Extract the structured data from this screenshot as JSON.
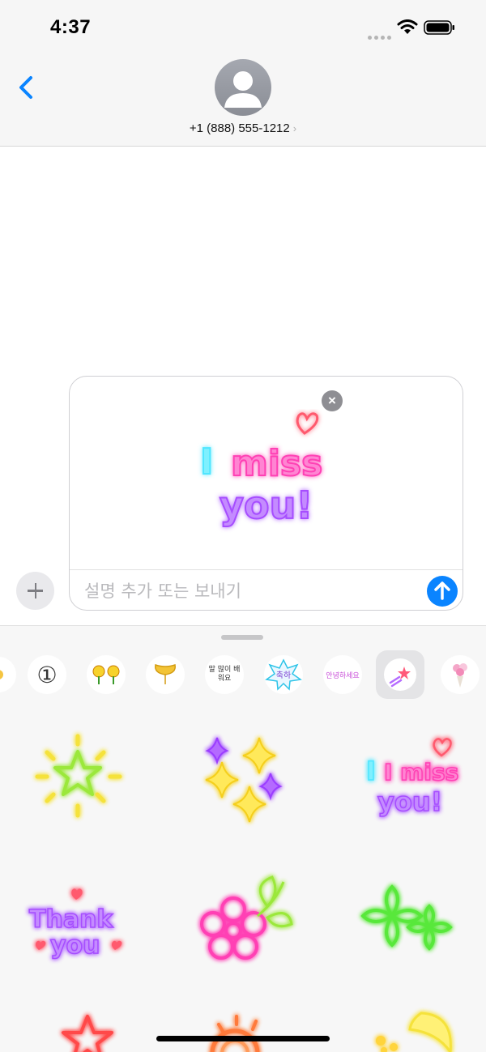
{
  "status_bar": {
    "time": "4:37"
  },
  "header": {
    "contact_name": "+1 (888) 555-1212",
    "chevron": "›"
  },
  "compose": {
    "placeholder": "설명 추가 또는 보내기",
    "attachment": {
      "sticker_lines": [
        "I",
        "miss",
        "you!"
      ]
    },
    "remove_glyph": "×"
  },
  "drawer": {
    "apps": [
      {
        "name": "number-one-sticker-app",
        "glyph": "①"
      },
      {
        "name": "flowers-sticker-app",
        "glyph": "✿✿"
      },
      {
        "name": "ginkgo-sticker-app",
        "glyph": "🍂"
      },
      {
        "name": "korean-text-sticker-app",
        "glyph": "말 많이 배워요"
      },
      {
        "name": "celebrate-sticker-app",
        "glyph": "축하"
      },
      {
        "name": "greeting-sticker-app",
        "glyph": "안녕하세요"
      },
      {
        "name": "neon-sticker-app",
        "glyph": "★"
      },
      {
        "name": "bouquet-sticker-app",
        "glyph": "💐"
      }
    ],
    "stickers": [
      {
        "name": "neon-star-burst",
        "text": ""
      },
      {
        "name": "neon-sparkles",
        "text": ""
      },
      {
        "name": "neon-i-miss-you",
        "text_top": "I miss",
        "text_bottom": "you!"
      },
      {
        "name": "neon-thank-you",
        "text_top": "Thank",
        "text_bottom": "you"
      },
      {
        "name": "neon-flower",
        "text": ""
      },
      {
        "name": "neon-clovers",
        "text": ""
      },
      {
        "name": "neon-star-outline",
        "text": ""
      },
      {
        "name": "neon-sun",
        "text": ""
      },
      {
        "name": "neon-moon",
        "text": ""
      }
    ]
  },
  "colors": {
    "accent": "#0a84ff",
    "neon_pink": "#ff3fb4",
    "neon_purple": "#a64dff",
    "neon_cyan": "#4fe6ff",
    "neon_yellow": "#f5e23a",
    "neon_green": "#59e83a",
    "neon_red": "#ff4a4a"
  }
}
